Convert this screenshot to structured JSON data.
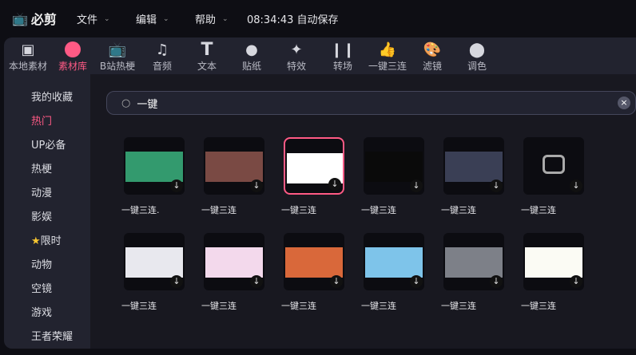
{
  "app": {
    "name": "必剪",
    "menus": [
      "文件",
      "编辑",
      "帮助"
    ],
    "status": "08:34:43 自动保存"
  },
  "toolbar": [
    {
      "label": "本地素材",
      "icon": "folder-upload-icon"
    },
    {
      "label": "素材库",
      "icon": "film-reel-icon",
      "active": true
    },
    {
      "label": "B站热梗",
      "icon": "bilibili-tv-icon"
    },
    {
      "label": "音频",
      "icon": "music-note-icon"
    },
    {
      "label": "文本",
      "icon": "text-t-icon"
    },
    {
      "label": "贴纸",
      "icon": "sticker-icon"
    },
    {
      "label": "特效",
      "icon": "magic-wand-icon"
    },
    {
      "label": "转场",
      "icon": "transition-icon"
    },
    {
      "label": "一键三连",
      "icon": "thumbs-up-icon"
    },
    {
      "label": "滤镜",
      "icon": "palette-icon"
    },
    {
      "label": "调色",
      "icon": "color-circles-icon"
    }
  ],
  "sidebar": [
    "我的收藏",
    "热门",
    "UP必备",
    "热梗",
    "动漫",
    "影娱",
    "限时",
    "动物",
    "空镜",
    "游戏",
    "王者荣耀"
  ],
  "search": {
    "value": "一键"
  },
  "accent": "#ff5a85",
  "results": [
    {
      "title": "一键三连.",
      "thumb": "#339a6e"
    },
    {
      "title": "一键三连",
      "thumb": "#7a4a44"
    },
    {
      "title": "一键三连",
      "thumb": "#ffffff"
    },
    {
      "title": "一键三连",
      "thumb": "#0a0a0a"
    },
    {
      "title": "一键三连",
      "thumb": "#3a3f55"
    },
    {
      "title": "一键三连",
      "thumb": "placeholder"
    },
    {
      "title": "一键三连",
      "thumb": "#e8e8ee"
    },
    {
      "title": "一键三连",
      "thumb": "#f3d9ec"
    },
    {
      "title": "一键三连",
      "thumb": "#d9683a"
    },
    {
      "title": "一键三连",
      "thumb": "#7ec4ea"
    },
    {
      "title": "一键三连",
      "thumb": "#7d8088"
    },
    {
      "title": "一键三连",
      "thumb": "#fbfbf4"
    }
  ]
}
